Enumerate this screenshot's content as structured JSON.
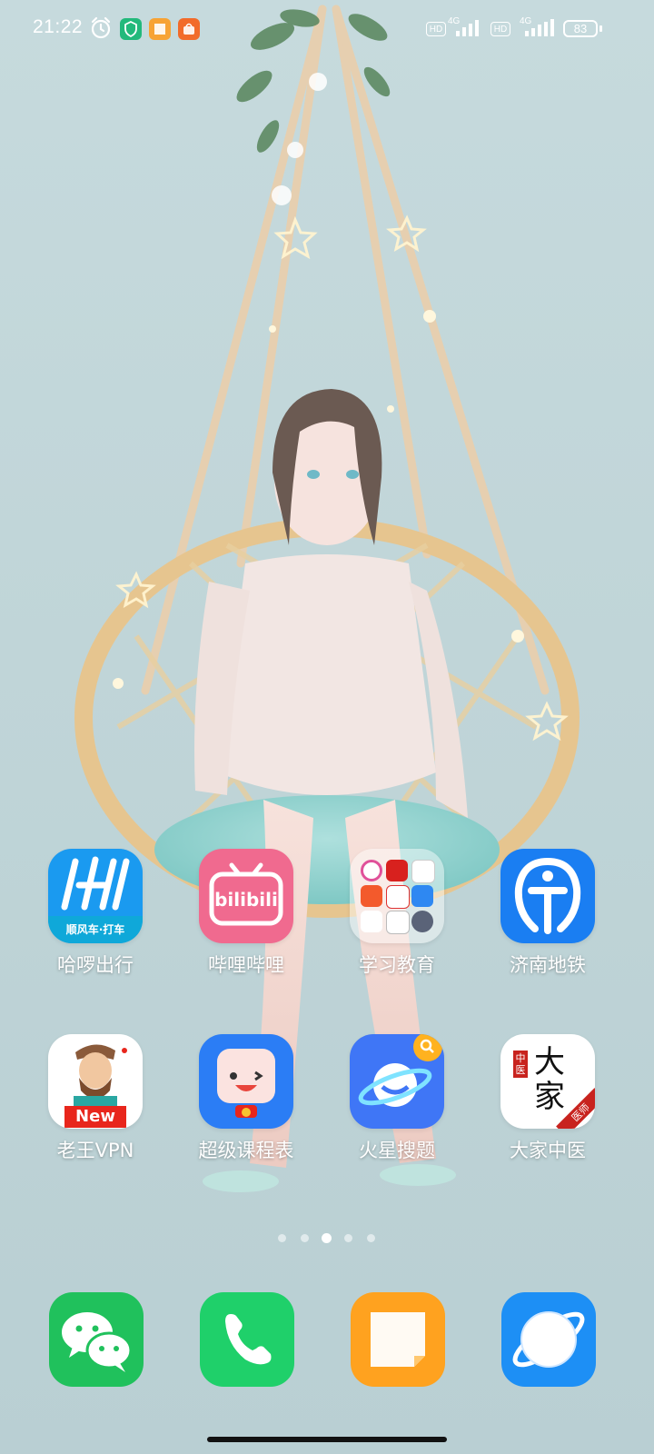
{
  "status_bar": {
    "time": "21:22",
    "network_left": {
      "hd": "HD",
      "type": "4G"
    },
    "network_right": {
      "hd": "HD",
      "type": "4G"
    },
    "battery": "83",
    "notification_icons": [
      "shield-icon",
      "notes-icon",
      "shop-icon"
    ]
  },
  "home": {
    "apps": [
      {
        "name": "哈啰出行",
        "icon_text": "顺风车·打车",
        "color": "#1a9af0"
      },
      {
        "name": "哔哩哔哩",
        "icon_text": "bilibili",
        "color": "#f06a8f"
      },
      {
        "name": "学习教育",
        "folder": true
      },
      {
        "name": "济南地铁",
        "color": "#1a7ef2"
      },
      {
        "name": "老王VPN",
        "icon_text": "New",
        "color": "#e8261c"
      },
      {
        "name": "超级课程表",
        "color": "#2b7df5"
      },
      {
        "name": "火星搜题",
        "color": "#3f76f6"
      },
      {
        "name": "大家中医",
        "icon_text_main": "大家",
        "icon_badge_top": "中医",
        "icon_badge_corner": "医师",
        "color": "#c8231e"
      }
    ],
    "page_indicator": {
      "count": 5,
      "active": 3
    }
  },
  "dock": [
    {
      "name": "wechat",
      "icon": "wechat-icon",
      "color": "#20c15c"
    },
    {
      "name": "phone",
      "icon": "phone-icon",
      "color": "#1fd06a"
    },
    {
      "name": "notes",
      "icon": "notes-icon",
      "color": "#ffa21f"
    },
    {
      "name": "browser",
      "icon": "browser-icon",
      "color": "#1d8ff5"
    }
  ]
}
